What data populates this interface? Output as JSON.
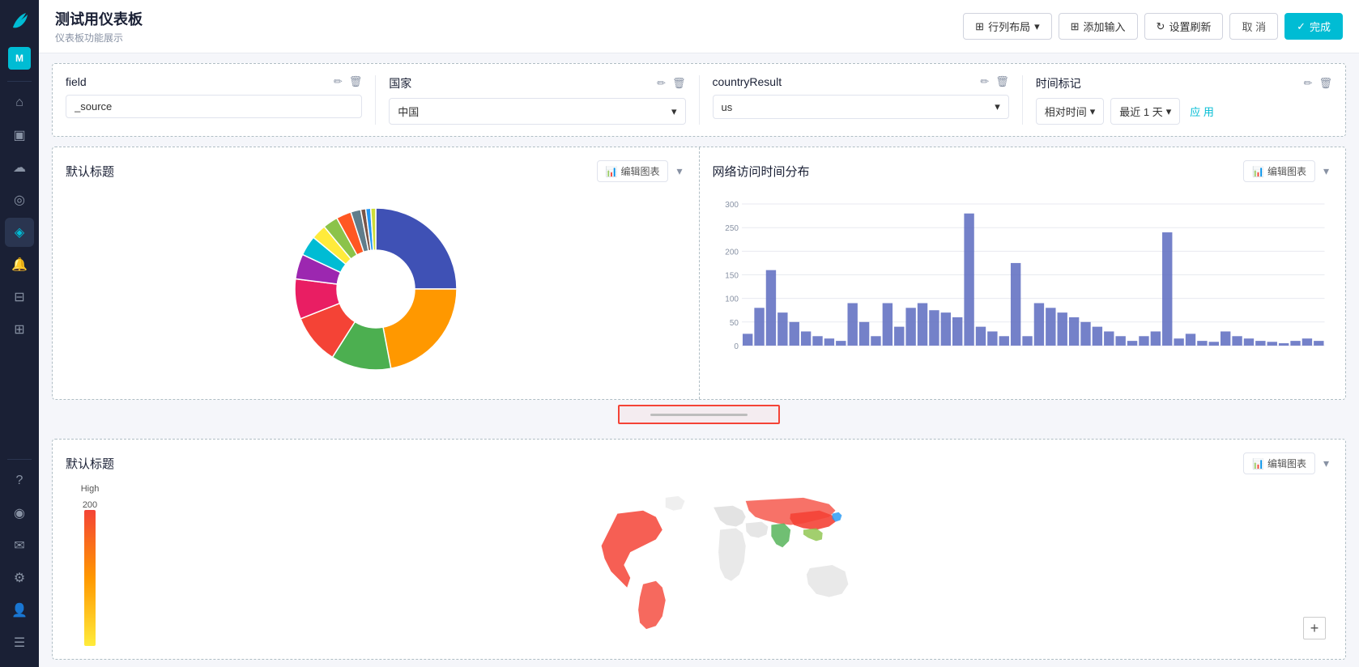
{
  "app": {
    "logo_text": "🐦",
    "avatar": "M"
  },
  "header": {
    "title": "测试用仪表板",
    "subtitle": "仪表板功能展示",
    "btn_layout": "行列布局",
    "btn_add_input": "添加输入",
    "btn_set_refresh": "设置刷新",
    "btn_cancel": "取 消",
    "btn_done": "完成"
  },
  "filters": [
    {
      "id": "filter-field",
      "label": "field",
      "type": "input",
      "value": "_source"
    },
    {
      "id": "filter-country",
      "label": "国家",
      "type": "select",
      "value": "中国"
    },
    {
      "id": "filter-countryresult",
      "label": "countryResult",
      "type": "select",
      "value": "us"
    },
    {
      "id": "filter-time",
      "label": "时间标记",
      "type": "time",
      "relative_label": "相对时间",
      "range_label": "最近 1 天",
      "apply_label": "应 用"
    }
  ],
  "chart1": {
    "title": "默认标题",
    "edit_label": "编辑图表",
    "donut_segments": [
      {
        "color": "#3f51b5",
        "value": 25,
        "start": 0
      },
      {
        "color": "#ff9800",
        "value": 22,
        "start": 25
      },
      {
        "color": "#4caf50",
        "value": 12,
        "start": 47
      },
      {
        "color": "#f44336",
        "value": 10,
        "start": 59
      },
      {
        "color": "#e91e63",
        "value": 8,
        "start": 69
      },
      {
        "color": "#9c27b0",
        "value": 5,
        "start": 77
      },
      {
        "color": "#00bcd4",
        "value": 4,
        "start": 82
      },
      {
        "color": "#ffeb3b",
        "value": 3,
        "start": 86
      },
      {
        "color": "#8bc34a",
        "value": 3,
        "start": 89
      },
      {
        "color": "#ff5722",
        "value": 3,
        "start": 92
      },
      {
        "color": "#607d8b",
        "value": 2,
        "start": 95
      },
      {
        "color": "#795548",
        "value": 1,
        "start": 97
      },
      {
        "color": "#2196f3",
        "value": 1,
        "start": 98
      },
      {
        "color": "#cddc39",
        "value": 1,
        "start": 99
      }
    ]
  },
  "chart2": {
    "title": "网络访问时间分布",
    "edit_label": "编辑图表",
    "y_labels": [
      "0",
      "50",
      "100",
      "150",
      "200",
      "250",
      "300"
    ],
    "bars": [
      25,
      80,
      160,
      70,
      50,
      30,
      20,
      15,
      10,
      90,
      50,
      20,
      90,
      40,
      80,
      90,
      75,
      70,
      60,
      280,
      40,
      30,
      20,
      175,
      20,
      90,
      80,
      70,
      60,
      50,
      40,
      30,
      20,
      10,
      20,
      30,
      240,
      15,
      25,
      10,
      8,
      30,
      20,
      15,
      10,
      8,
      5,
      10,
      15,
      10
    ]
  },
  "resize_handle": {},
  "chart3": {
    "title": "默认标题",
    "edit_label": "编辑图表",
    "legend_high": "High",
    "legend_value": "200"
  },
  "sidebar_icons": [
    {
      "name": "home-icon",
      "symbol": "⌂",
      "active": false
    },
    {
      "name": "user-icon",
      "symbol": "👤",
      "active": false
    },
    {
      "name": "notification-icon",
      "symbol": "🔔",
      "active": false
    },
    {
      "name": "cloud-icon",
      "symbol": "☁",
      "active": false
    },
    {
      "name": "search-icon",
      "symbol": "🔍",
      "active": false
    },
    {
      "name": "analytics-icon",
      "symbol": "📊",
      "active": true
    },
    {
      "name": "bell-icon",
      "symbol": "🔔",
      "active": false
    },
    {
      "name": "database-icon",
      "symbol": "🗄",
      "active": false
    },
    {
      "name": "layers-icon",
      "symbol": "⊞",
      "active": false
    },
    {
      "name": "question-icon",
      "symbol": "?",
      "active": false
    },
    {
      "name": "bulb-icon",
      "symbol": "💡",
      "active": false
    },
    {
      "name": "chat-icon",
      "symbol": "💬",
      "active": false
    },
    {
      "name": "settings-icon",
      "symbol": "⚙",
      "active": false
    },
    {
      "name": "person-icon",
      "symbol": "👤",
      "active": false
    },
    {
      "name": "menu-icon",
      "symbol": "☰",
      "active": false
    }
  ]
}
